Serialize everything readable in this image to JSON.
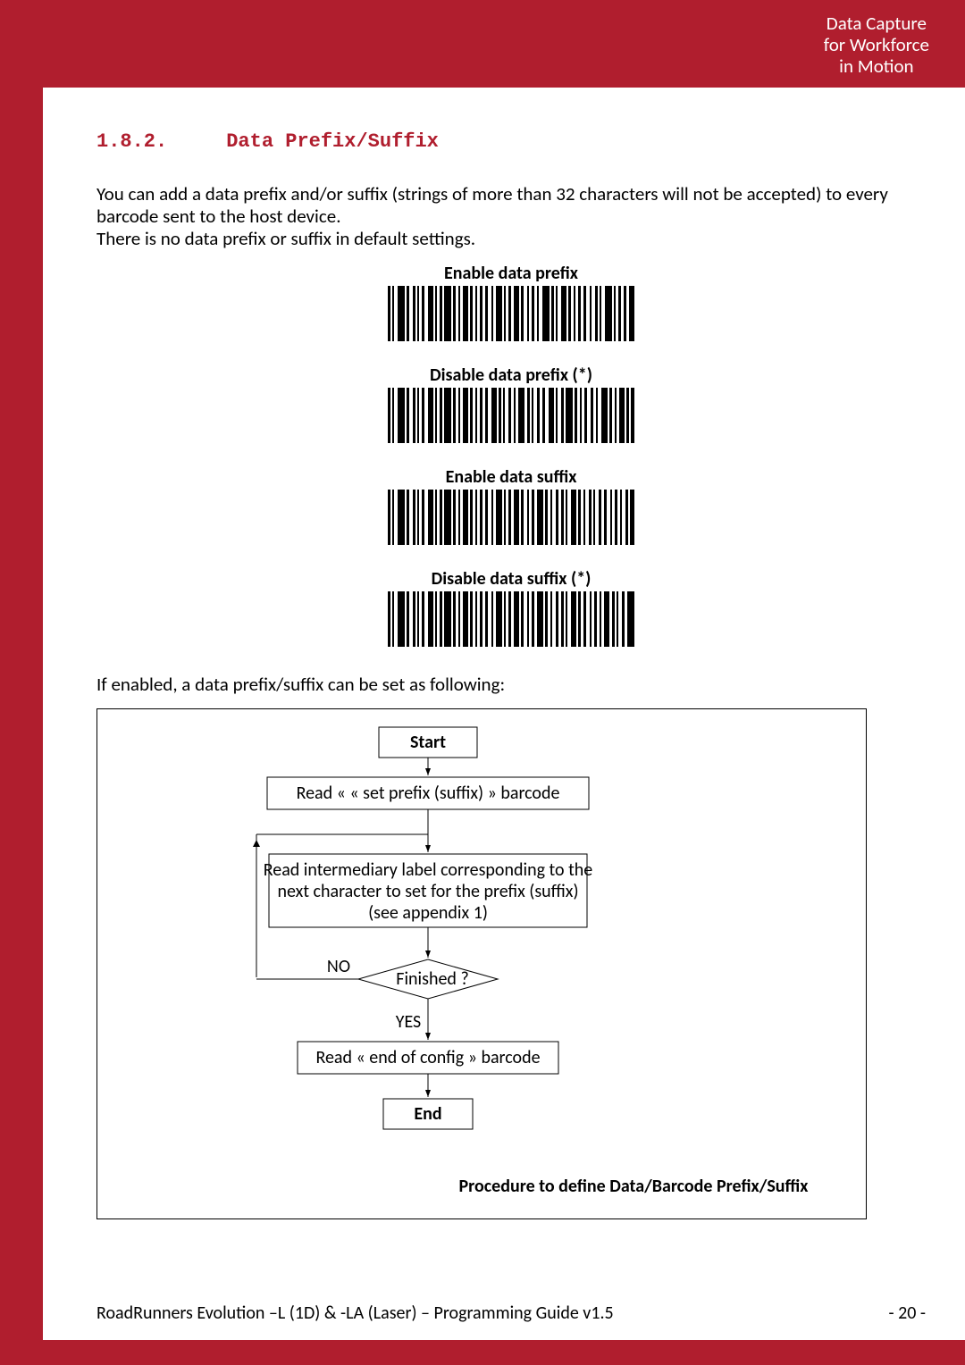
{
  "header": {
    "line1": "Data Capture",
    "line2": "for Workforce",
    "line3": "in Motion"
  },
  "section": {
    "number": "1.8.2.",
    "title": "Data Prefix/Suffix"
  },
  "body": {
    "p1": "You can add a data prefix and/or suffix (strings of more than 32 characters will not be accepted) to every barcode sent to the host device.",
    "p2": "There is no data prefix or suffix in default settings."
  },
  "barcodes": [
    {
      "label": "Enable data prefix"
    },
    {
      "label": "Disable data prefix (*)"
    },
    {
      "label": "Enable data suffix"
    },
    {
      "label": "Disable data suffix (*)"
    }
  ],
  "flow_intro": "If enabled, a data prefix/suffix can be set as following:",
  "flow": {
    "start": "Start",
    "step1": "Read « « set prefix (suffix) » barcode",
    "step2a": "Read intermediary label corresponding to the",
    "step2b": "next character to set for the prefix (suffix)",
    "step2c": "(see appendix 1)",
    "decision": "Finished ?",
    "no": "NO",
    "yes": "YES",
    "step3": "Read « end of config » barcode",
    "end": "End",
    "caption": "Procedure to define Data/Barcode Prefix/Suffix"
  },
  "footer": {
    "left": "RoadRunners Evolution –L (1D) & -LA (Laser) – Programming Guide v1.5",
    "right": "- 20 -"
  }
}
